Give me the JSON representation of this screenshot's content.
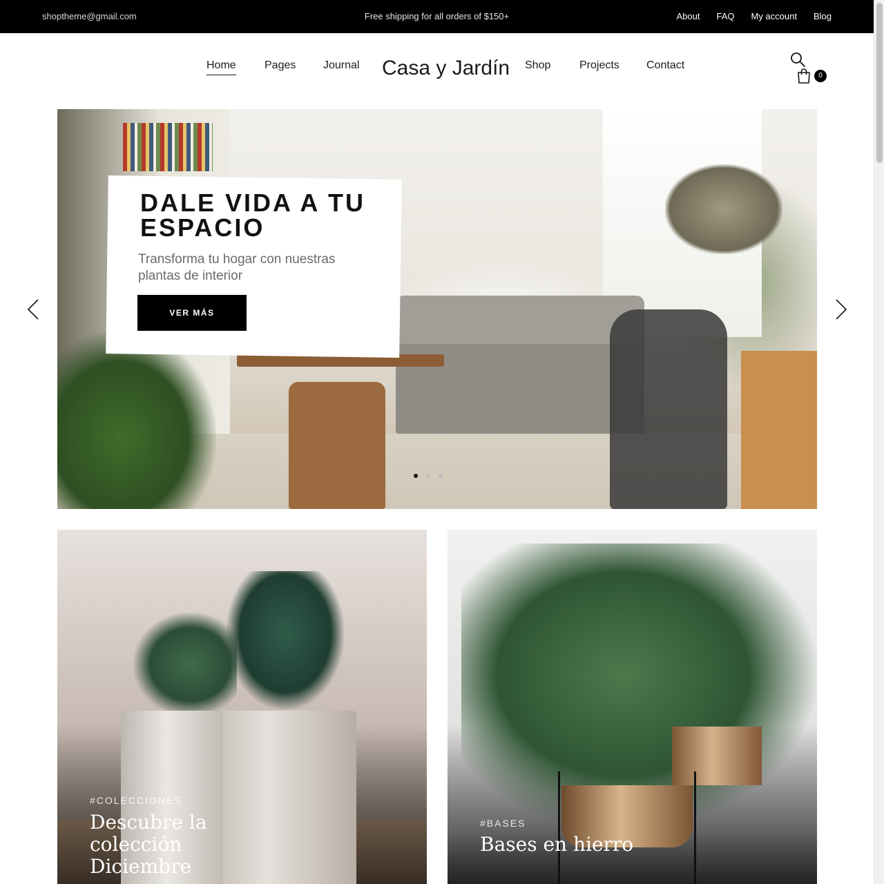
{
  "topbar": {
    "email": "shoptheme@gmail.com",
    "promo": "Free shipping for all orders of $150+",
    "links": [
      "About",
      "FAQ",
      "My account",
      "Blog"
    ]
  },
  "header": {
    "brand": "Casa y Jardín",
    "nav_left": [
      "Home",
      "Pages",
      "Journal"
    ],
    "nav_right": [
      "Shop",
      "Projects",
      "Contact"
    ],
    "active": "Home",
    "cart_count": "0"
  },
  "hero": {
    "title": "DALE VIDA A TU ESPACIO",
    "subtitle": "Transforma tu hogar con nuestras plantas de interior",
    "button": "VER MÁS",
    "slides": 3,
    "active_slide": 1
  },
  "banners": [
    {
      "tag": "#COLECCIONES",
      "title": "Descubre la colección Diciembre"
    },
    {
      "tag": "#BASES",
      "title": "Bases en hierro"
    }
  ],
  "colors": {
    "topbar": "#000000",
    "accent": "#000000",
    "text": "#111111"
  },
  "icons": [
    "search-icon",
    "cart-icon",
    "chevron-left-icon",
    "chevron-right-icon"
  ]
}
